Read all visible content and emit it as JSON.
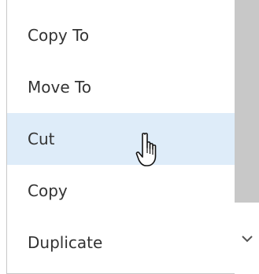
{
  "menu": {
    "items": [
      {
        "label": "Copy To"
      },
      {
        "label": "Move To"
      },
      {
        "label": "Cut"
      },
      {
        "label": "Copy"
      },
      {
        "label": "Duplicate"
      }
    ],
    "highlighted_index": 2
  },
  "colors": {
    "highlight": "#deecf9",
    "text": "#333333",
    "scroll_thumb": "#c8c8c8",
    "border": "#c8c8c8"
  },
  "icons": {
    "cursor": "hand-pointer-icon",
    "scroll_down": "chevron-down-icon"
  }
}
